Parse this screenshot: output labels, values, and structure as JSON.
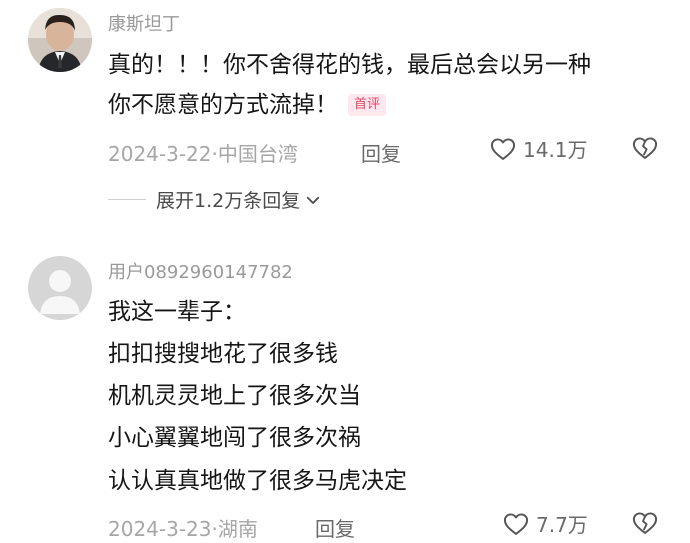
{
  "comments": [
    {
      "username": "康斯坦丁",
      "lines": [
        "真的！！！你不舍得花的钱，最后总会以另一种",
        "你不愿意的方式流掉！"
      ],
      "badge": "首评",
      "date": "2024-3-22",
      "separator": "·",
      "location": "中国台湾",
      "reply_label": "回复",
      "likes": "14.1万",
      "expand_label": "展开1.2万条回复",
      "avatar": "profile-photo"
    },
    {
      "username": "用户0892960147782",
      "lines": [
        "我这一辈子：",
        "扣扣搜搜地花了很多钱",
        "机机灵灵地上了很多次当",
        "小心翼翼地闯了很多次祸",
        "认认真真地做了很多马虎决定"
      ],
      "date": "2024-3-23",
      "separator": "·",
      "location": "湖南",
      "reply_label": "回复",
      "likes": "7.7万",
      "avatar": "default-user-avatar"
    }
  ],
  "icons": {
    "like": "heart-outline-icon",
    "dislike": "broken-heart-icon",
    "expand": "chevron-down-icon"
  },
  "colors": {
    "text": "#161616",
    "muted": "#a6a6a6",
    "badge_text": "#e0456a",
    "badge_bg": "#fde8ee"
  }
}
